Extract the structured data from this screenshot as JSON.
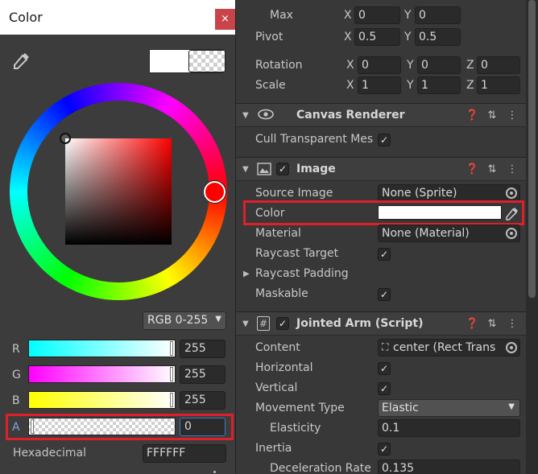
{
  "picker": {
    "title": "Color",
    "close_label": "×",
    "mode": "RGB 0-255",
    "channels": [
      {
        "label": "R",
        "value": "255"
      },
      {
        "label": "G",
        "value": "255"
      },
      {
        "label": "B",
        "value": "255"
      },
      {
        "label": "A",
        "value": "0"
      }
    ],
    "hex_label": "Hexadecimal",
    "hex_value": "FFFFFF"
  },
  "inspector": {
    "max_label": "Max",
    "max_x": "0",
    "max_y": "0",
    "pivot_label": "Pivot",
    "pivot_x": "0.5",
    "pivot_y": "0.5",
    "rotation_label": "Rotation",
    "rot_x": "0",
    "rot_y": "0",
    "rot_z": "0",
    "scale_label": "Scale",
    "scale_x": "1",
    "scale_y": "1",
    "scale_z": "1",
    "axis_x": "X",
    "axis_y": "Y",
    "axis_z": "Z",
    "canvas_renderer": {
      "title": "Canvas Renderer",
      "cull_label": "Cull Transparent Mes"
    },
    "image": {
      "title": "Image",
      "source_label": "Source Image",
      "source_value": "None (Sprite)",
      "color_label": "Color",
      "material_label": "Material",
      "material_value": "None (Material)",
      "raycast_target_label": "Raycast Target",
      "raycast_padding_label": "Raycast Padding",
      "maskable_label": "Maskable"
    },
    "script": {
      "title": "Jointed Arm (Script)",
      "content_label": "Content",
      "content_value": "center (Rect Trans",
      "horizontal_label": "Horizontal",
      "vertical_label": "Vertical",
      "movement_label": "Movement Type",
      "movement_value": "Elastic",
      "elasticity_label": "Elasticity",
      "elasticity_value": "0.1",
      "inertia_label": "Inertia",
      "decel_label": "Deceleration Rate",
      "decel_value": "0.135"
    }
  },
  "colors": {
    "highlight": "#e01f2a",
    "selected_color": "#ffffff"
  }
}
